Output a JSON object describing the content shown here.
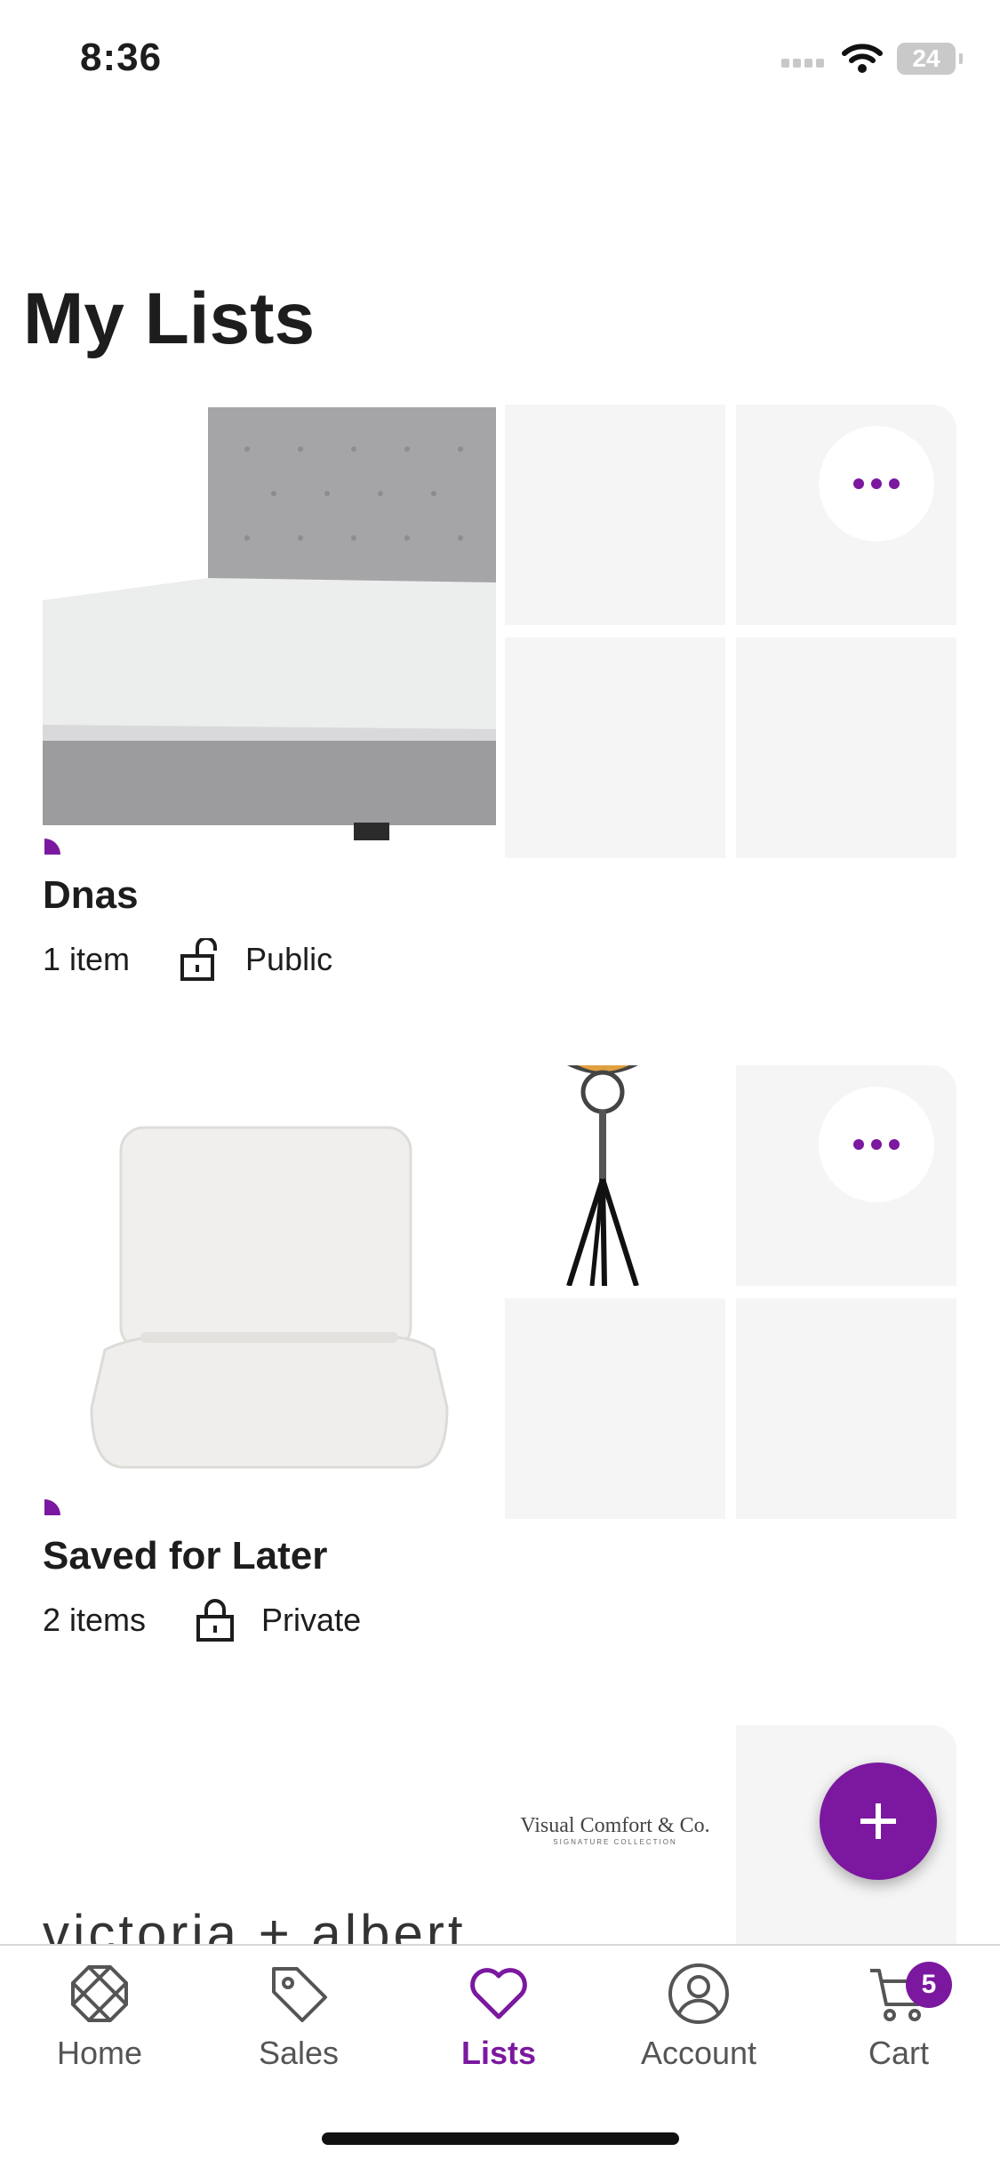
{
  "status_bar": {
    "time": "8:36",
    "battery": "24"
  },
  "page": {
    "title": "My Lists"
  },
  "lists": [
    {
      "name": "Dnas",
      "count": "1 item",
      "visibility": "Public"
    },
    {
      "name": "Saved for Later",
      "count": "2 items",
      "visibility": "Private"
    }
  ],
  "third_list": {
    "brand_1": "Visual Comfort & Co.",
    "brand_1_sub": "SIGNATURE COLLECTION",
    "brand_2": "victoria + albert"
  },
  "nav": {
    "items": [
      {
        "label": "Home"
      },
      {
        "label": "Sales"
      },
      {
        "label": "Lists"
      },
      {
        "label": "Account"
      },
      {
        "label": "Cart"
      }
    ],
    "cart_count": "5"
  },
  "colors": {
    "accent": "#7b189f",
    "tile": "#f5f5f5"
  }
}
